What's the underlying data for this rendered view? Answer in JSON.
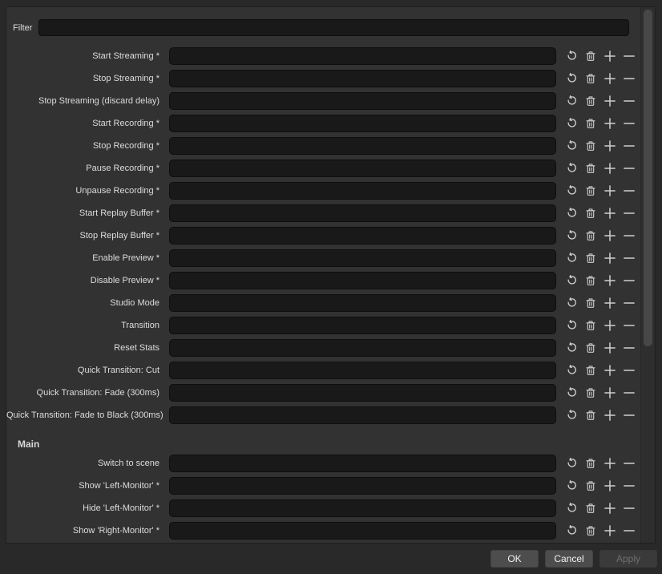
{
  "filter": {
    "label": "Filter",
    "value": ""
  },
  "sections": [
    {
      "header": "",
      "rows": [
        {
          "label": "Start Streaming *",
          "value": ""
        },
        {
          "label": "Stop Streaming *",
          "value": ""
        },
        {
          "label": "Stop Streaming (discard delay)",
          "value": ""
        },
        {
          "label": "Start Recording *",
          "value": ""
        },
        {
          "label": "Stop Recording *",
          "value": ""
        },
        {
          "label": "Pause Recording *",
          "value": ""
        },
        {
          "label": "Unpause Recording *",
          "value": ""
        },
        {
          "label": "Start Replay Buffer *",
          "value": ""
        },
        {
          "label": "Stop Replay Buffer *",
          "value": ""
        },
        {
          "label": "Enable Preview *",
          "value": ""
        },
        {
          "label": "Disable Preview *",
          "value": ""
        },
        {
          "label": "Studio Mode",
          "value": ""
        },
        {
          "label": "Transition",
          "value": ""
        },
        {
          "label": "Reset Stats",
          "value": ""
        },
        {
          "label": "Quick Transition: Cut",
          "value": ""
        },
        {
          "label": "Quick Transition: Fade (300ms)",
          "value": ""
        },
        {
          "label": "Quick Transition: Fade to Black (300ms)",
          "value": ""
        }
      ]
    },
    {
      "header": "Main",
      "rows": [
        {
          "label": "Switch to scene",
          "value": ""
        },
        {
          "label": "Show 'Left-Monitor' *",
          "value": ""
        },
        {
          "label": "Hide 'Left-Monitor' *",
          "value": ""
        },
        {
          "label": "Show 'Right-Monitor' *",
          "value": ""
        }
      ]
    }
  ],
  "row_actions": [
    {
      "name": "revert",
      "icon": "undo-icon"
    },
    {
      "name": "clear",
      "icon": "trash-icon"
    },
    {
      "name": "add",
      "icon": "plus-icon"
    },
    {
      "name": "remove",
      "icon": "minus-icon"
    }
  ],
  "footer": {
    "ok_label": "OK",
    "cancel_label": "Cancel",
    "apply_label": "Apply",
    "apply_disabled": true
  },
  "colors": {
    "dialog_bg": "#292929",
    "panel_bg": "#323232",
    "input_bg": "#191919",
    "text": "#dcdcdc",
    "icon": "#cfcfcf",
    "button_bg": "#4d4d4d",
    "disabled_text": "#6f6f6f"
  }
}
